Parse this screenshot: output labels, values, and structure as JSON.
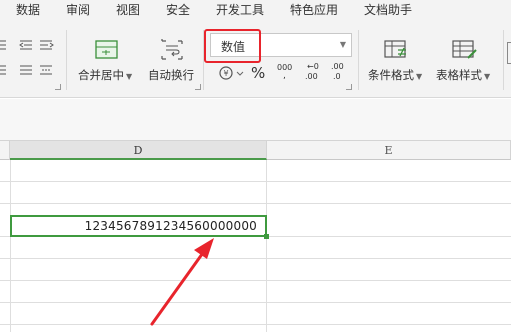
{
  "menu": {
    "tabs": [
      "数据",
      "审阅",
      "视图",
      "安全",
      "开发工具",
      "特色应用",
      "文档助手"
    ]
  },
  "ribbon": {
    "merge_center_label": "合并居中",
    "wrap_text_label": "自动换行",
    "number_format_value": "数值",
    "percent_symbol": "%",
    "thousands_label": "000",
    "increase_decimal_label": ".00",
    "decrease_decimal_label": ".0",
    "conditional_format_label": "条件格式",
    "table_style_label": "表格样式"
  },
  "sheet": {
    "columns": [
      "D",
      "E"
    ],
    "selected_column": "D",
    "active_cell_value": "123456789123456000000 0"
  },
  "colors": {
    "highlight_red": "#e8242c",
    "selection_green": "#3f9a3f",
    "ribbon_bg": "#f3f3f3"
  }
}
